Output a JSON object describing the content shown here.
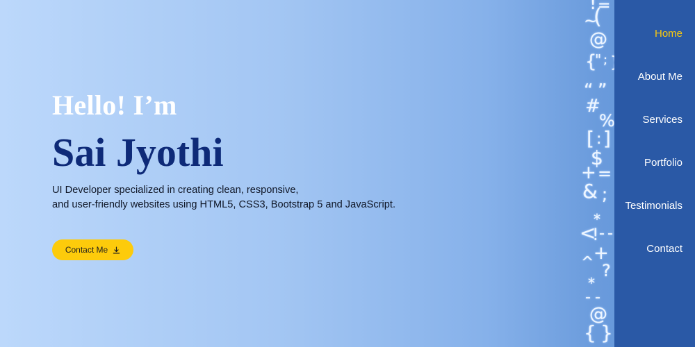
{
  "hero": {
    "greeting": "Hello! I’m",
    "name": "Sai Jyothi",
    "description": [
      "UI Developer specialized in creating clean, responsive,",
      "and user-friendly websites using HTML5, CSS3, Bootstrap 5 and JavaScript."
    ],
    "cta_label": "Contact Me",
    "cta_icon": "download-icon"
  },
  "nav": {
    "items": [
      "Home",
      "About Me",
      "Services",
      "Portfolio",
      "Testimonials",
      "Contact"
    ],
    "active": "Home"
  },
  "symbols": [
    "!",
    "=",
    "~",
    "(",
    "@",
    "{",
    "\"",
    ";",
    "}",
    "“",
    "”",
    "#",
    "%",
    "[",
    ":",
    "]",
    "$",
    "+",
    "=",
    "&",
    ";",
    "*",
    "<",
    "!",
    "-",
    "-",
    "^",
    "+",
    "?",
    "*",
    "-",
    "-",
    "@",
    "{",
    "}"
  ],
  "colors": {
    "brand_navy": "#0e2a78",
    "accent_yellow": "#fdcb0b",
    "sidebar_blue": "#2a59a6"
  }
}
